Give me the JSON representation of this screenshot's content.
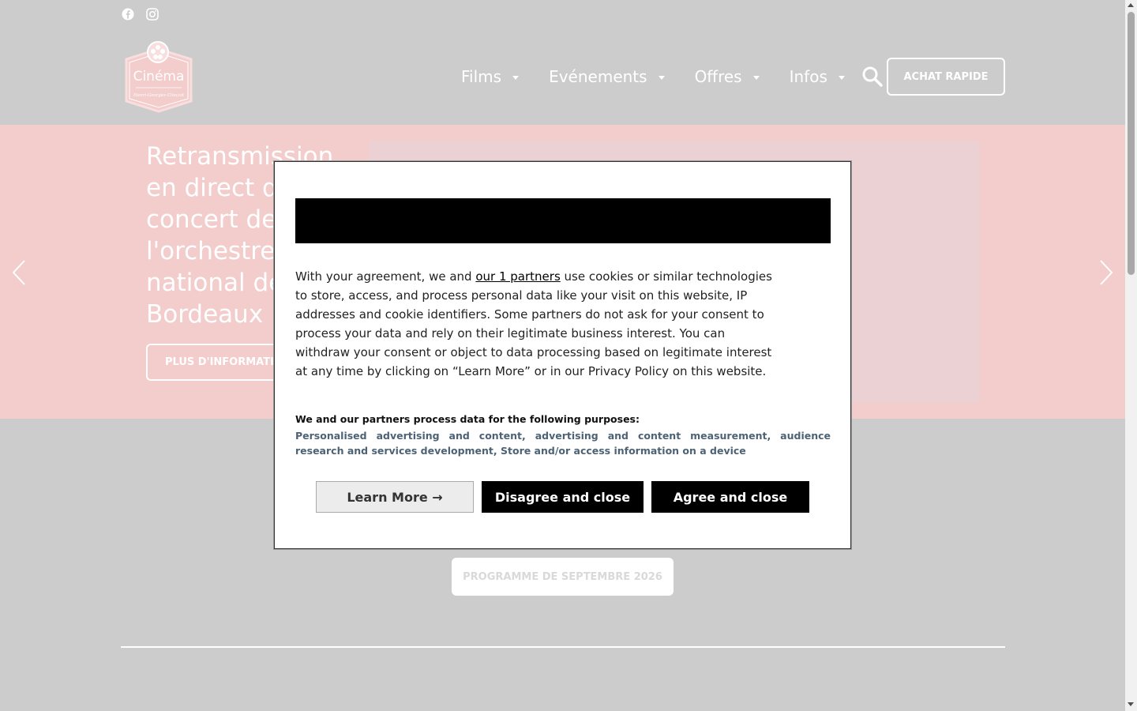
{
  "header": {
    "social": [
      {
        "icon": "facebook-icon"
      },
      {
        "icon": "instagram-icon"
      }
    ],
    "logo": {
      "text": "Cinéma",
      "subtext": "Henri-Georges Clouzot"
    },
    "nav": [
      {
        "label": "Films"
      },
      {
        "label": "Evénements"
      },
      {
        "label": "Offres"
      },
      {
        "label": "Infos"
      }
    ],
    "search_icon": "search-icon",
    "quick_buy_label": "ACHAT RAPIDE"
  },
  "hero": {
    "title": "Retransmission en direct du concert de l'orchestre national de Bordeaux",
    "button_label": "PLUS D'INFORMATIONS"
  },
  "main": {
    "program_button_label": "PROGRAMME DE SEPTEMBRE 2026"
  },
  "consent": {
    "text_before_link": "With your agreement, we and ",
    "partners_link": "our 1 partners",
    "text_after_link": " use cookies or similar technologies to store, access, and process personal data like your visit on this website, IP addresses and cookie identifiers. Some partners do not ask for your consent to process your data and rely on their legitimate business interest. You can withdraw your consent or object to data processing based on legitimate interest at any time by clicking on “Learn More” or in our Privacy Policy on this website.",
    "purposes_title": "We and our partners process data for the following purposes:",
    "purposes_list": "Personalised advertising and content, advertising and content measurement, audience research and services development, Store and/or access information on a device",
    "learn_more_label": "Learn More →",
    "disagree_label": "Disagree and close",
    "agree_label": "Agree and close"
  },
  "colors": {
    "page_dim": "#cccccc",
    "hero_bg": "#f3cccc",
    "purposes_text": "#4d6275"
  }
}
